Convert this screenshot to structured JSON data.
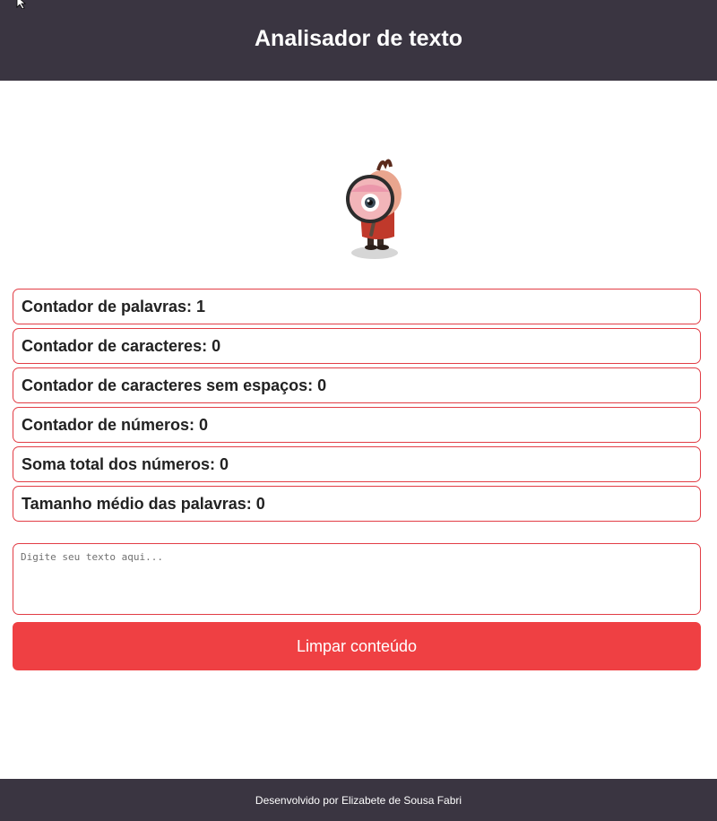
{
  "header": {
    "title": "Analisador de texto"
  },
  "mascot": {
    "icon": "magnifier-mascot-icon"
  },
  "stats": [
    {
      "label": "Contador de palavras: ",
      "value": "1"
    },
    {
      "label": "Contador de caracteres: ",
      "value": "0"
    },
    {
      "label": "Contador de caracteres sem espaços: ",
      "value": "0"
    },
    {
      "label": "Contador de números: ",
      "value": "0"
    },
    {
      "label": "Soma total dos números: ",
      "value": "0"
    },
    {
      "label": "Tamanho médio das palavras: ",
      "value": "0"
    }
  ],
  "input": {
    "placeholder": "Digite seu texto aqui...",
    "value": ""
  },
  "actions": {
    "clear_label": "Limpar conteúdo"
  },
  "footer": {
    "credit": "Desenvolvido por Elizabete de Sousa Fabri"
  },
  "colors": {
    "header_bg": "#3a3541",
    "accent": "#ef4043",
    "border": "#e23d45"
  }
}
